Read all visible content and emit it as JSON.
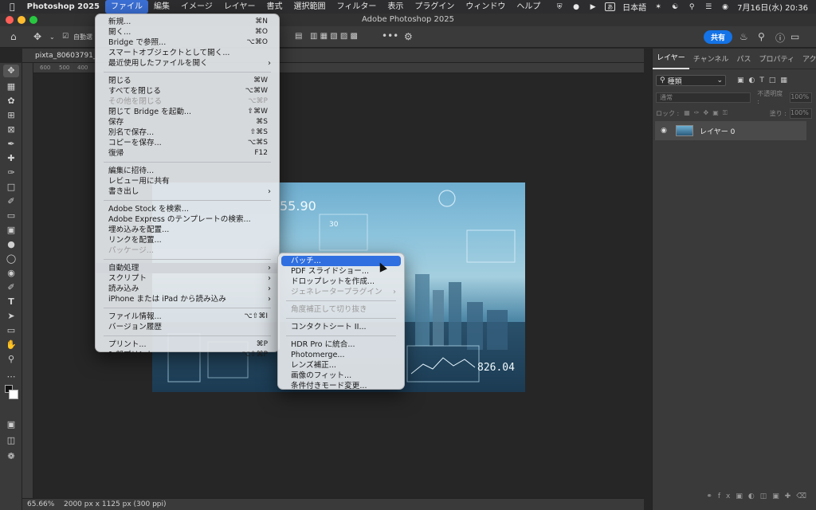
{
  "menubar": {
    "app": "Photoshop 2025",
    "items": [
      "ファイル",
      "編集",
      "イメージ",
      "レイヤー",
      "書式",
      "選択範囲",
      "フィルター",
      "表示",
      "プラグイン",
      "ウィンドウ",
      "ヘルプ"
    ],
    "input_mode": "あ",
    "language": "日本語",
    "datetime": "7月16日(水) 20:36"
  },
  "window": {
    "title": "Adobe Photoshop 2025"
  },
  "optionsbar": {
    "auto_select": "自動選",
    "more": "•••",
    "share": "共有"
  },
  "document": {
    "tab": "pixta_80603791_",
    "zoom": "65.66%",
    "info": "2000 px x 1125 px (300 ppi)"
  },
  "ruler": {
    "ticks": [
      "600",
      "500",
      "400"
    ]
  },
  "image_text": {
    "top_number": "55.90",
    "mid_number": "30",
    "bottom_number": "826.04"
  },
  "panel": {
    "tabs": [
      "レイヤー",
      "チャンネル",
      "パス",
      "プロパティ",
      "アクショ"
    ],
    "filter": "種類",
    "blend": "通常",
    "opacity_label": "不透明度 :",
    "opacity_value": "100%",
    "lock_label": "ロック :",
    "fill_label": "塗り :",
    "fill_value": "100%",
    "layer_name": "レイヤー 0"
  },
  "file_menu": {
    "items": [
      {
        "label": "新規...",
        "shortcut": "⌘N"
      },
      {
        "label": "開く...",
        "shortcut": "⌘O"
      },
      {
        "label": "Bridge で参照...",
        "shortcut": "⌥⌘O"
      },
      {
        "label": "スマートオブジェクトとして開く..."
      },
      {
        "label": "最近使用したファイルを開く",
        "submenu": true
      },
      {
        "sep": true
      },
      {
        "label": "閉じる",
        "shortcut": "⌘W"
      },
      {
        "label": "すべてを閉じる",
        "shortcut": "⌥⌘W"
      },
      {
        "label": "その他を閉じる",
        "shortcut": "⌥⌘P",
        "disabled": true
      },
      {
        "label": "閉じて Bridge を起動...",
        "shortcut": "⇧⌘W"
      },
      {
        "label": "保存",
        "shortcut": "⌘S"
      },
      {
        "label": "別名で保存...",
        "shortcut": "⇧⌘S"
      },
      {
        "label": "コピーを保存...",
        "shortcut": "⌥⌘S"
      },
      {
        "label": "復帰",
        "shortcut": "F12"
      },
      {
        "sep": true
      },
      {
        "label": "編集に招待..."
      },
      {
        "label": "レビュー用に共有"
      },
      {
        "label": "書き出し",
        "submenu": true
      },
      {
        "sep": true
      },
      {
        "label": "Adobe Stock を検索..."
      },
      {
        "label": "Adobe Express のテンプレートの検索..."
      },
      {
        "label": "埋め込みを配置..."
      },
      {
        "label": "リンクを配置..."
      },
      {
        "label": "パッケージ...",
        "disabled": true
      },
      {
        "sep": true
      },
      {
        "label": "自動処理",
        "submenu": true,
        "highlighted": true
      },
      {
        "label": "スクリプト",
        "submenu": true
      },
      {
        "label": "読み込み",
        "submenu": true
      },
      {
        "label": "iPhone または iPad から読み込み",
        "submenu": true
      },
      {
        "sep": true
      },
      {
        "label": "ファイル情報...",
        "shortcut": "⌥⇧⌘I"
      },
      {
        "label": "バージョン履歴"
      },
      {
        "sep": true
      },
      {
        "label": "プリント...",
        "shortcut": "⌘P"
      },
      {
        "label": "1 部プリント",
        "shortcut": "⌥⇧⌘P"
      }
    ]
  },
  "automate_menu": {
    "items": [
      {
        "label": "バッチ...",
        "selected": true
      },
      {
        "label": "PDF スライドショー..."
      },
      {
        "label": "ドロップレットを作成..."
      },
      {
        "label": "ジェネレータープラグイン",
        "submenu": true,
        "disabled": true
      },
      {
        "sep": true
      },
      {
        "label": "角度補正して切り抜き",
        "disabled": true
      },
      {
        "sep": true
      },
      {
        "label": "コンタクトシート II..."
      },
      {
        "sep": true
      },
      {
        "label": "HDR Pro に統合..."
      },
      {
        "label": "Photomerge..."
      },
      {
        "label": "レンズ補正..."
      },
      {
        "label": "画像のフィット..."
      },
      {
        "label": "条件付きモード変更..."
      }
    ]
  }
}
